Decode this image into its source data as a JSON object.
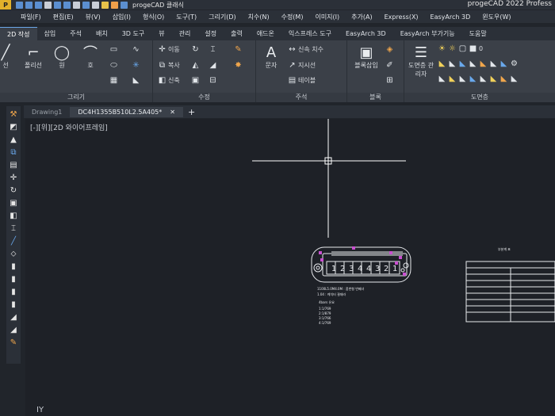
{
  "title_bar": {
    "workspace": "progeCAD 클래식",
    "app_title": "progeCAD 2022 Profess"
  },
  "menu": [
    "파일(F)",
    "편집(E)",
    "뷰(V)",
    "삽입(I)",
    "형식(O)",
    "도구(T)",
    "그리기(D)",
    "치수(N)",
    "수정(M)",
    "이미지(I)",
    "추가(A)",
    "Express(X)",
    "EasyArch 3D",
    "윈도우(W)"
  ],
  "ribbon_tabs": [
    "2D 작성",
    "삽입",
    "주석",
    "배치",
    "3D 도구",
    "뷰",
    "관리",
    "설정",
    "출력",
    "애드온",
    "익스프레스 도구",
    "EasyArch 3D",
    "EasyArch 부가기능",
    "도움말"
  ],
  "ribbon": {
    "draw": {
      "title": "그리기",
      "line": "선",
      "polyline": "폴리선",
      "circle": "원",
      "arc": "호"
    },
    "modify": {
      "title": "수정",
      "move": "이동",
      "copy": "복사",
      "stretch": "신축"
    },
    "annotation": {
      "title": "주석",
      "text": "문자",
      "dim": "신속 치수",
      "leader": "지시선",
      "table": "테이블"
    },
    "block": {
      "title": "블록",
      "insert": "블록삽입"
    },
    "layers": {
      "title": "도면층",
      "manager": "도면층 관리자",
      "count": "0"
    }
  },
  "doc_tabs": [
    "Drawing1",
    "DC4H1355B510L2.5A405*"
  ],
  "canvas": {
    "view_label": "[2D 와이어프레임]",
    "view_prefix": "[-][위]",
    "ucs_label": "Y",
    "drawing_text": {
      "line1": "1100L5.0M4.0M : 품번형 번째녀",
      "line2": "1.04 : 케치터 결재라",
      "sub": "4bars 유요",
      "values": [
        "1:1/769",
        "2:1/879",
        "3:1/766",
        "4:1/769"
      ],
      "table_title": "부분계 표",
      "cells": [
        "1",
        "2",
        "3",
        "4",
        "4",
        "3",
        "2",
        "1"
      ]
    }
  }
}
